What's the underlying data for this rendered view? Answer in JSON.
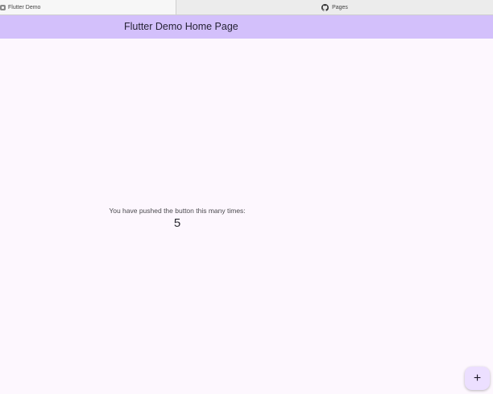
{
  "browser": {
    "tabs": [
      {
        "label": "Flutter Demo",
        "icon": "flutter-icon"
      },
      {
        "label": "Pages",
        "icon": "github-icon"
      }
    ]
  },
  "app_bar": {
    "title": "Flutter Demo Home Page",
    "background_color": "#d3c0fb"
  },
  "main": {
    "counter_label": "You have pushed the button this many times:",
    "counter_value": "5"
  },
  "fab": {
    "icon": "plus-icon",
    "glyph": "+",
    "background_color": "#ecdfff"
  },
  "colors": {
    "page_background": "#fdf7fe"
  }
}
